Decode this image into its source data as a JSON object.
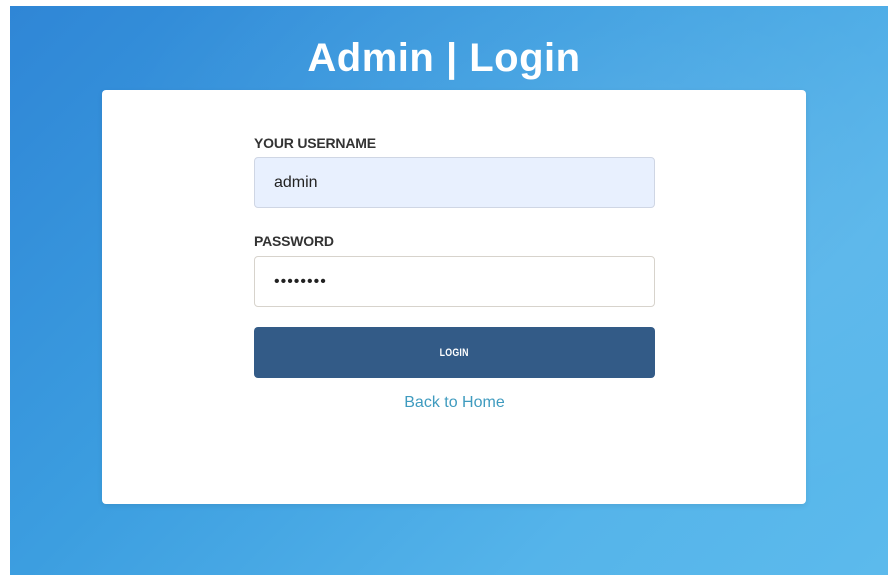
{
  "header": {
    "title": "Admin | Login"
  },
  "login_form": {
    "username": {
      "label": "YOUR USERNAME",
      "value": "admin"
    },
    "password": {
      "label": "PASSWORD",
      "value": "••••••••"
    },
    "submit_label": "LOGIN",
    "back_link_label": "Back to Home"
  },
  "colors": {
    "background_start": "#2f86d6",
    "background_end": "#5cbaec",
    "card": "#ffffff",
    "username_fill": "#e8f0fe",
    "button": "#335b87",
    "link": "#3f9bbf"
  }
}
